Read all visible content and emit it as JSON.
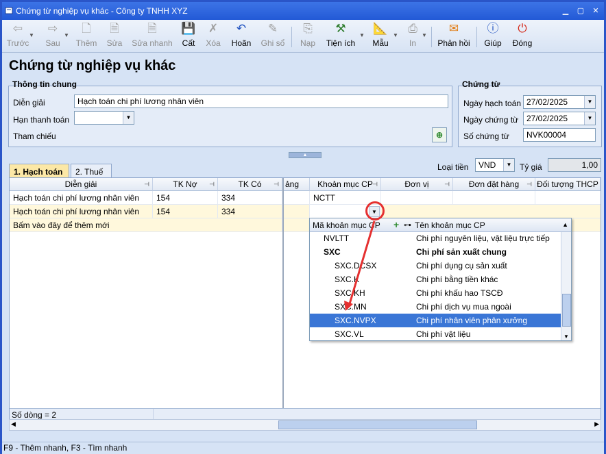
{
  "window": {
    "title": "Chứng từ nghiệp vụ khác - Công ty TNHH XYZ"
  },
  "toolbar": {
    "prev": "Trước",
    "next": "Sau",
    "add": "Thêm",
    "edit": "Sửa",
    "quick_edit": "Sửa nhanh",
    "save": "Cất",
    "delete": "Xóa",
    "undo": "Hoãn",
    "post": "Ghi sổ",
    "load": "Nạp",
    "utility": "Tiện ích",
    "template": "Mẫu",
    "print": "In",
    "feedback": "Phản hồi",
    "help": "Giúp",
    "close": "Đóng"
  },
  "page_title": "Chứng từ nghiệp vụ khác",
  "general": {
    "group_title": "Thông tin chung",
    "description_label": "Diễn giải",
    "description_value": "Hạch toán chi phí lương nhân viên",
    "due_label": "Hạn thanh toán",
    "due_value": "",
    "ref_label": "Tham chiếu"
  },
  "voucher": {
    "group_title": "Chứng từ",
    "posting_date_label": "Ngày hạch toán",
    "posting_date": "27/02/2025",
    "voucher_date_label": "Ngày chứng từ",
    "voucher_date": "27/02/2025",
    "voucher_no_label": "Số chứng từ",
    "voucher_no": "NVK00004"
  },
  "tabs": {
    "accounting": "1. Hạch toán",
    "tax": "2. Thuế"
  },
  "currency": {
    "label": "Loại tiền",
    "value": "VND",
    "rate_label": "Tỷ giá",
    "rate": "1,00"
  },
  "grid": {
    "headers": {
      "desc": "Diễn giải",
      "debit": "TK Nợ",
      "credit": "TK Có",
      "amount": "ảng",
      "cost_item": "Khoản mục CP",
      "unit": "Đơn vị",
      "order": "Đơn đặt hàng",
      "cost_object": "Đối tượng THCP"
    },
    "rows": [
      {
        "desc": "Hạch toán chi phí lương nhân viên",
        "debit": "154",
        "credit": "334",
        "cost_item": "NCTT"
      },
      {
        "desc": "Hạch toán chi phí lương nhân viên",
        "debit": "154",
        "credit": "334",
        "cost_item": ""
      }
    ],
    "add_new": "Bấm vào đây để thêm mới",
    "row_count": "Số dòng = 2"
  },
  "popup": {
    "col_code": "Mã khoản mục CP",
    "col_name": "Tên khoản mục CP",
    "items": [
      {
        "code": "NVLTT",
        "name": "Chi phí nguyên liệu, vật liệu trực tiếp"
      },
      {
        "code": "SXC",
        "name": "Chi phí sản xuất chung"
      },
      {
        "code": "SXC.DCSX",
        "name": "Chi phí dụng cụ sản xuất"
      },
      {
        "code": "SXC.K",
        "name": "Chi phí bằng tiền khác"
      },
      {
        "code": "SXC.KH",
        "name": "Chi phí khấu hao TSCĐ"
      },
      {
        "code": "SXC.MN",
        "name": "Chi phí dịch vụ mua ngoài"
      },
      {
        "code": "SXC.NVPX",
        "name": "Chi phí nhân viên phân xưởng"
      },
      {
        "code": "SXC.VL",
        "name": "Chi phí vật liệu"
      }
    ]
  },
  "status": "F9 - Thêm nhanh, F3 - Tìm nhanh",
  "colors": {
    "accent": "#3a76d6",
    "highlight_row": "#fff8dc",
    "annotation": "#e53030"
  }
}
